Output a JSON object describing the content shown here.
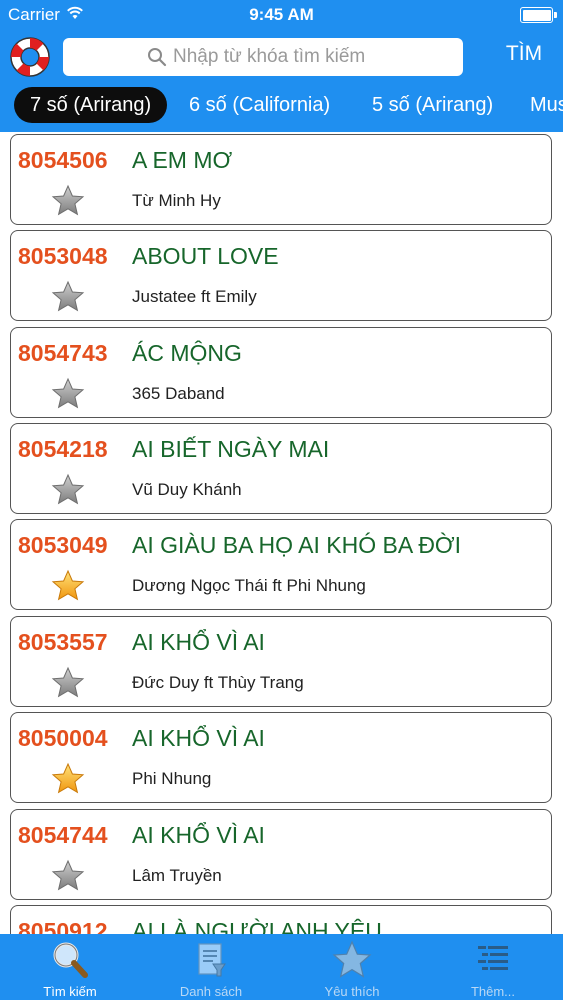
{
  "status_bar": {
    "carrier": "Carrier",
    "time": "9:45 AM"
  },
  "search": {
    "placeholder": "Nhập từ khóa tìm kiếm",
    "button_label": "TÌM"
  },
  "tabs": [
    {
      "label": "7 số (Arirang)",
      "active": true
    },
    {
      "label": "6 số (California)",
      "active": false
    },
    {
      "label": "5 số (Arirang)",
      "active": false
    },
    {
      "label": "Mus",
      "active": false
    }
  ],
  "songs": [
    {
      "code": "8054506",
      "title": "A EM MƠ",
      "artist": "Từ Minh Hy",
      "favorite": false
    },
    {
      "code": "8053048",
      "title": "ABOUT LOVE",
      "artist": "Justatee ft Emily",
      "favorite": false
    },
    {
      "code": "8054743",
      "title": "ÁC MỘNG",
      "artist": "365 Daband",
      "favorite": false
    },
    {
      "code": "8054218",
      "title": "AI BIẾT NGÀY MAI",
      "artist": "Vũ Duy Khánh",
      "favorite": false
    },
    {
      "code": "8053049",
      "title": "AI GIÀU BA HỌ AI KHÓ BA ĐỜI",
      "artist": "Dương Ngọc Thái ft Phi Nhung",
      "favorite": true
    },
    {
      "code": "8053557",
      "title": "AI KHỔ VÌ AI",
      "artist": "Đức Duy ft Thùy Trang",
      "favorite": false
    },
    {
      "code": "8050004",
      "title": "AI KHỔ VÌ AI",
      "artist": "Phi Nhung",
      "favorite": true
    },
    {
      "code": "8054744",
      "title": "AI KHỔ VÌ AI",
      "artist": "Lâm Truyền",
      "favorite": false
    },
    {
      "code": "8050912",
      "title": "AI LÀ NGƯỜI ANH YÊU",
      "artist": "",
      "favorite": false
    }
  ],
  "tabbar": [
    {
      "label": "Tìm kiếm",
      "icon": "magnifier-icon",
      "active": true
    },
    {
      "label": "Danh sách",
      "icon": "document-list-icon",
      "active": false
    },
    {
      "label": "Yêu thích",
      "icon": "star-icon",
      "active": false
    },
    {
      "label": "Thêm...",
      "icon": "more-list-icon",
      "active": false
    }
  ],
  "colors": {
    "header_blue": "#1f8ff0",
    "code_orange": "#e4501e",
    "title_green": "#17662b",
    "favorite_gold": "#f5a623",
    "star_gray": "#8a8a8a"
  }
}
